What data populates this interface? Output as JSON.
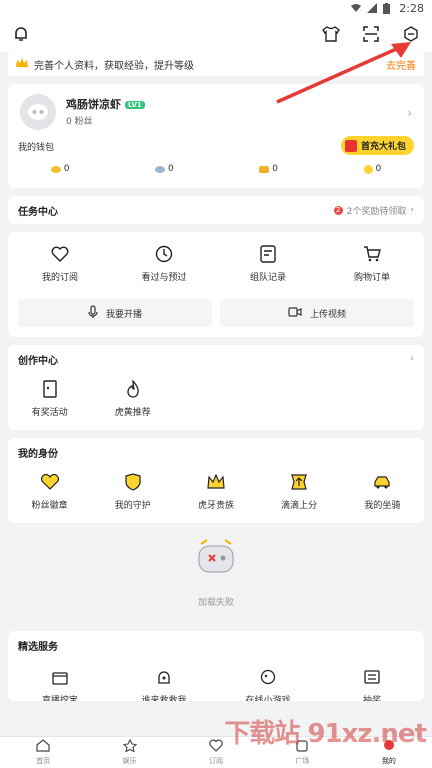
{
  "status_bar": {
    "time": "2:28"
  },
  "banner": {
    "text": "完善个人资料，获取经验，提升等级",
    "link": "去完善"
  },
  "profile": {
    "username": "鸡肠饼凉虾",
    "level": "LV1",
    "fans": "0 粉丝",
    "wallet_label": "我的钱包",
    "gift_label": "首充大礼包",
    "wallet": [
      "0",
      "0",
      "0",
      "0"
    ]
  },
  "tasks": {
    "title": "任务中心",
    "badge": "2",
    "aux": "2个奖励待领取",
    "items": [
      "我的订阅",
      "看过与预过",
      "组队记录",
      "购物订单"
    ],
    "buttons": [
      "我要开播",
      "上传视频"
    ]
  },
  "creation": {
    "title": "创作中心",
    "items": [
      "有奖活动",
      "虎黄推荐"
    ]
  },
  "identity": {
    "title": "我的身份",
    "items": [
      "粉丝徽章",
      "我的守护",
      "虎牙贵族",
      "滴滴上分",
      "我的坐骑"
    ]
  },
  "load_fail": {
    "text": "加载失败"
  },
  "services": {
    "title": "精选服务",
    "items": [
      "直播挖宝",
      "谁来救救我",
      "在线小游戏",
      "抽奖"
    ]
  },
  "tabbar": [
    "首页",
    "娱乐",
    "订阅",
    "广场",
    "我的"
  ],
  "watermark": "下载站 91xz.net",
  "colors": {
    "accent_yellow": "#ffd32e",
    "link_orange": "#ff7a00",
    "arrow_red": "#e53935",
    "level_green": "#34c47c"
  }
}
